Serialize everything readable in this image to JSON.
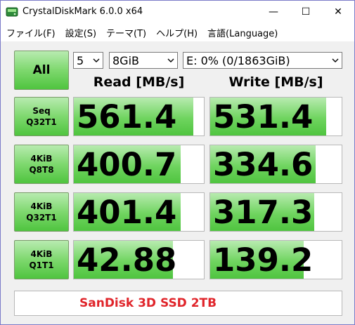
{
  "window": {
    "title": "CrystalDiskMark 6.0.0 x64",
    "minimize_glyph": "—",
    "maximize_glyph": "☐",
    "close_glyph": "✕"
  },
  "menu": {
    "items": [
      {
        "label": "ファイル(F)"
      },
      {
        "label": "設定(S)"
      },
      {
        "label": "テーマ(T)"
      },
      {
        "label": "ヘルプ(H)"
      },
      {
        "label": "言語(Language)"
      }
    ]
  },
  "controls": {
    "all_label": "All",
    "runs": "5",
    "size": "8GiB",
    "drive": "E: 0% (0/1863GiB)"
  },
  "headers": {
    "read": "Read [MB/s]",
    "write": "Write [MB/s]"
  },
  "tests": [
    {
      "line1": "Seq",
      "line2": "Q32T1",
      "read": "561.4",
      "write": "531.4",
      "read_fill": 0.92,
      "write_fill": 0.88
    },
    {
      "line1": "4KiB",
      "line2": "Q8T8",
      "read": "400.7",
      "write": "334.6",
      "read_fill": 0.82,
      "write_fill": 0.8
    },
    {
      "line1": "4KiB",
      "line2": "Q32T1",
      "read": "401.4",
      "write": "317.3",
      "read_fill": 0.82,
      "write_fill": 0.79
    },
    {
      "line1": "4KiB",
      "line2": "Q1T1",
      "read": "42.88",
      "write": "139.2",
      "read_fill": 0.76,
      "write_fill": 0.71
    }
  ],
  "comment": "SanDisk 3D SSD 2TB",
  "colors": {
    "accent_green": "#4fc43f",
    "comment_red": "#e0242a"
  }
}
